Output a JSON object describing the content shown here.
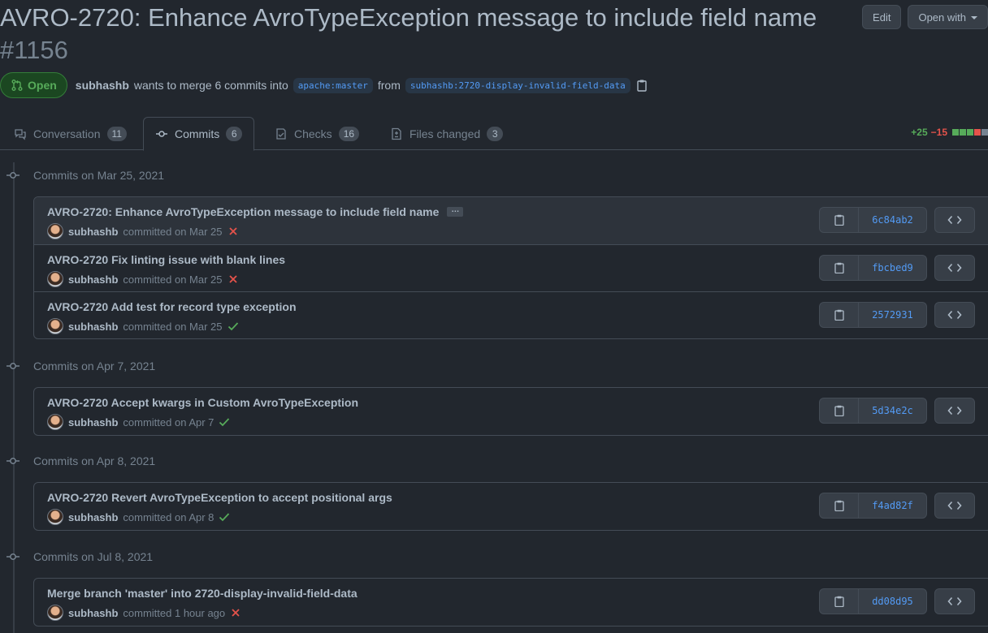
{
  "pr": {
    "title": "AVRO-2720: Enhance AvroTypeException message to include field name",
    "number": "#1156",
    "state": "Open",
    "author": "subhashb",
    "merge_text": "wants to merge 6 commits into",
    "base_branch": "apache:master",
    "from_text": "from",
    "head_branch": "subhashb:2720-display-invalid-field-data"
  },
  "header_actions": {
    "edit": "Edit",
    "open_with": "Open with"
  },
  "tabs": [
    {
      "label": "Conversation",
      "count": "11"
    },
    {
      "label": "Commits",
      "count": "6"
    },
    {
      "label": "Checks",
      "count": "16"
    },
    {
      "label": "Files changed",
      "count": "3"
    }
  ],
  "diffstat": {
    "additions": "+25",
    "deletions": "−15"
  },
  "groups": [
    {
      "date_label": "Commits on Mar 25, 2021",
      "commits": [
        {
          "message": "AVRO-2720: Enhance AvroTypeException message to include field name",
          "author": "subhashb",
          "committed": "committed on Mar 25",
          "status": "failure",
          "sha": "6c84ab2"
        },
        {
          "message": "AVRO-2720 Fix linting issue with blank lines",
          "author": "subhashb",
          "committed": "committed on Mar 25",
          "status": "failure",
          "sha": "fbcbed9"
        },
        {
          "message": "AVRO-2720 Add test for record type exception",
          "author": "subhashb",
          "committed": "committed on Mar 25",
          "status": "success",
          "sha": "2572931"
        }
      ]
    },
    {
      "date_label": "Commits on Apr 7, 2021",
      "commits": [
        {
          "message": "AVRO-2720 Accept kwargs in Custom AvroTypeException",
          "author": "subhashb",
          "committed": "committed on Apr 7",
          "status": "success",
          "sha": "5d34e2c"
        }
      ]
    },
    {
      "date_label": "Commits on Apr 8, 2021",
      "commits": [
        {
          "message": "AVRO-2720 Revert AvroTypeException to accept positional args",
          "author": "subhashb",
          "committed": "committed on Apr 8",
          "status": "success",
          "sha": "f4ad82f"
        }
      ]
    },
    {
      "date_label": "Commits on Jul 8, 2021",
      "commits": [
        {
          "message": "Merge branch 'master' into 2720-display-invalid-field-data",
          "author": "subhashb",
          "committed": "committed 1 hour ago",
          "status": "failure",
          "sha": "dd08d95"
        }
      ]
    }
  ]
}
